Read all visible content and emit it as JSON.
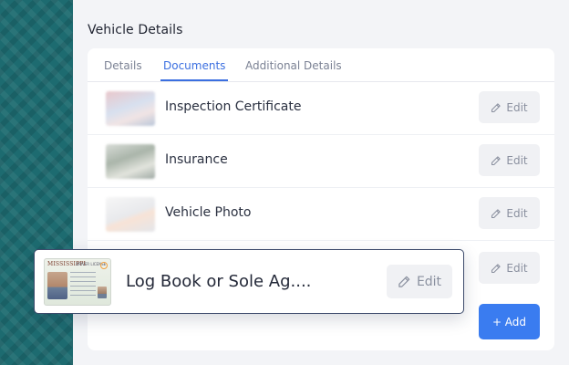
{
  "page": {
    "title": "Vehicle Details"
  },
  "tabs": [
    {
      "label": "Details"
    },
    {
      "label": "Documents"
    },
    {
      "label": "Additional Details"
    }
  ],
  "documents": [
    {
      "label": "Inspection Certificate",
      "edit_label": "Edit"
    },
    {
      "label": "Insurance",
      "edit_label": "Edit"
    },
    {
      "label": "Vehicle Photo",
      "edit_label": "Edit"
    },
    {
      "label": "",
      "edit_label": "Edit"
    }
  ],
  "add_button": {
    "label": "+ Add"
  },
  "floating_card": {
    "label": "Log Book or Sole Ag....",
    "edit_label": "Edit",
    "license_title": "MISSISSIPPI",
    "license_subtitle": "DRIVER LICENSE"
  },
  "colors": {
    "accent": "#3a7cf0",
    "tab_active": "#3b6fe0",
    "side_panel": "#1d6b70"
  },
  "icons": {
    "edit": "pencil-icon"
  }
}
